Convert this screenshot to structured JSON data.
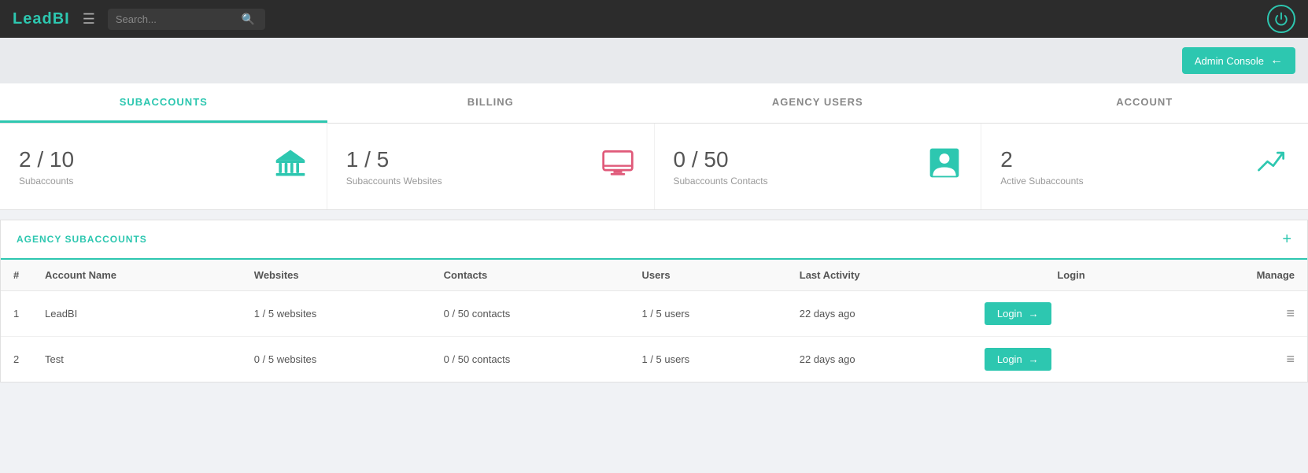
{
  "topnav": {
    "logo_lead": "Lead",
    "logo_bi": "BI",
    "search_placeholder": "Search...",
    "power_icon": "⏻"
  },
  "admin_bar": {
    "button_label": "Admin Console",
    "button_arrow": "←"
  },
  "tabs": [
    {
      "id": "subaccounts",
      "label": "SUBACCOUNTS",
      "active": true
    },
    {
      "id": "billing",
      "label": "BILLING",
      "active": false
    },
    {
      "id": "agency-users",
      "label": "AGENCY USERS",
      "active": false
    },
    {
      "id": "account",
      "label": "ACCOUNT",
      "active": false
    }
  ],
  "stats": [
    {
      "number": "2 / 10",
      "label": "Subaccounts",
      "icon": "bank"
    },
    {
      "number": "1 / 5",
      "label": "Subaccounts Websites",
      "icon": "screen"
    },
    {
      "number": "0 / 50",
      "label": "Subaccounts Contacts",
      "icon": "person"
    },
    {
      "number": "2",
      "label": "Active Subaccounts",
      "icon": "trending"
    }
  ],
  "section": {
    "title": "AGENCY SUBACCOUNTS",
    "add_icon": "+"
  },
  "table": {
    "headers": [
      "#",
      "Account Name",
      "Websites",
      "Contacts",
      "Users",
      "Last Activity",
      "Login",
      "Manage"
    ],
    "rows": [
      {
        "num": "1",
        "account_name": "LeadBI",
        "websites": "1 / 5 websites",
        "contacts": "0 / 50 contacts",
        "users": "1 / 5 users",
        "last_activity": "22 days ago",
        "login_label": "Login"
      },
      {
        "num": "2",
        "account_name": "Test",
        "websites": "0 / 5 websites",
        "contacts": "0 / 50 contacts",
        "users": "1 / 5 users",
        "last_activity": "22 days ago",
        "login_label": "Login"
      }
    ]
  }
}
